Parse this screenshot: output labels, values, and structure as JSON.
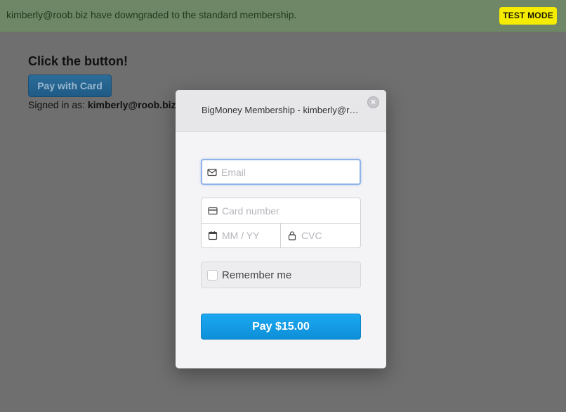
{
  "banner": {
    "message": "kimberly@roob.biz have downgraded to the standard membership.",
    "test_mode_label": "TEST MODE"
  },
  "page": {
    "heading": "Click the button!",
    "pay_with_card_label": "Pay with Card",
    "signed_in_prefix": "Signed in as:",
    "signed_in_user": "kimberly@roob.biz"
  },
  "modal": {
    "title": "BigMoney Membership - kimberly@roob.biz",
    "close_glyph": "×",
    "email": {
      "value": "",
      "placeholder": "Email",
      "icon": "envelope-icon"
    },
    "card_number": {
      "value": "",
      "placeholder": "Card number",
      "icon": "credit-card-icon"
    },
    "expiry": {
      "value": "",
      "placeholder": "MM / YY",
      "icon": "calendar-icon"
    },
    "cvc": {
      "value": "",
      "placeholder": "CVC",
      "icon": "lock-icon"
    },
    "remember_label": "Remember me",
    "remember_checked": false,
    "pay_button_label": "Pay $15.00"
  },
  "colors": {
    "test_badge": "#f5ec00",
    "pay_button": "#1ba8f0",
    "focus_border": "#8fb3e8"
  }
}
